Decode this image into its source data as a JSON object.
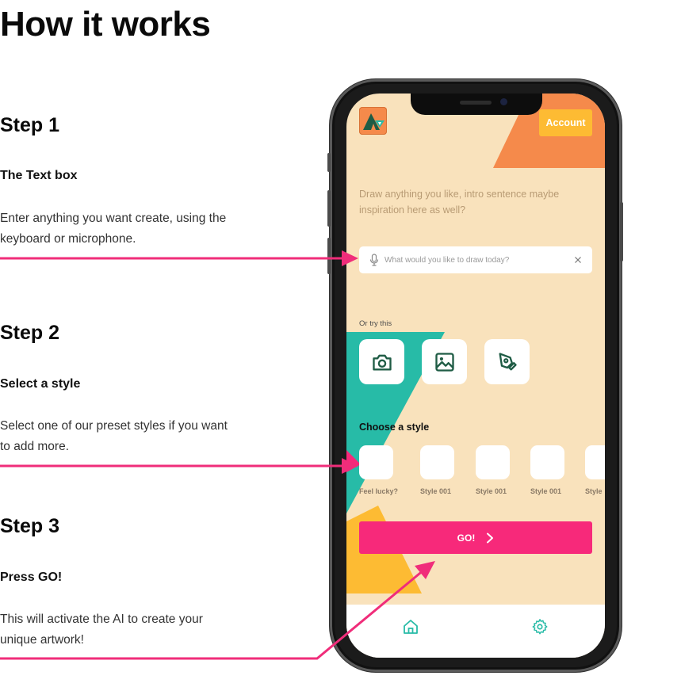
{
  "page": {
    "title": "How it works"
  },
  "steps": [
    {
      "heading": "Step 1",
      "subheading": "The Text box",
      "body_line1": "Enter anything you want create, using the",
      "body_line2": "keyboard or microphone."
    },
    {
      "heading": "Step 2",
      "subheading": "Select a style",
      "body_line1": "Select one of our preset styles if you want",
      "body_line2": "to add more."
    },
    {
      "heading": "Step 3",
      "subheading": "Press GO!",
      "body_line1": "This will activate the AI to create your",
      "body_line2": "unique artwork!"
    }
  ],
  "colors": {
    "accent_pink": "#f02d7a",
    "app_background": "#f9e2bc",
    "orange": "#f58a4b",
    "teal": "#27bba7",
    "yellow": "#fdbb33",
    "icon_green": "#1f5c45"
  },
  "app": {
    "logo_icon": "tent-logo-icon",
    "account_label": "Account",
    "intro_text": "Draw anything you like, intro sentence maybe inspiration here as well?",
    "search": {
      "placeholder": "What would you like to draw today?",
      "value": "",
      "mic_icon": "microphone-icon",
      "clear_icon": "close-icon"
    },
    "try_label": "Or try this",
    "tools": [
      {
        "icon": "camera-icon"
      },
      {
        "icon": "image-icon"
      },
      {
        "icon": "pen-tool-icon"
      }
    ],
    "style_heading": "Choose a style",
    "styles": [
      {
        "label": "Feel lucky?"
      },
      {
        "label": "Style 001"
      },
      {
        "label": "Style 001"
      },
      {
        "label": "Style 001"
      },
      {
        "label": "Style"
      }
    ],
    "go_label": "GO!",
    "go_icon": "chevron-right-icon",
    "tab_bar": [
      {
        "icon": "home-icon"
      },
      {
        "icon": "settings-icon"
      }
    ]
  }
}
